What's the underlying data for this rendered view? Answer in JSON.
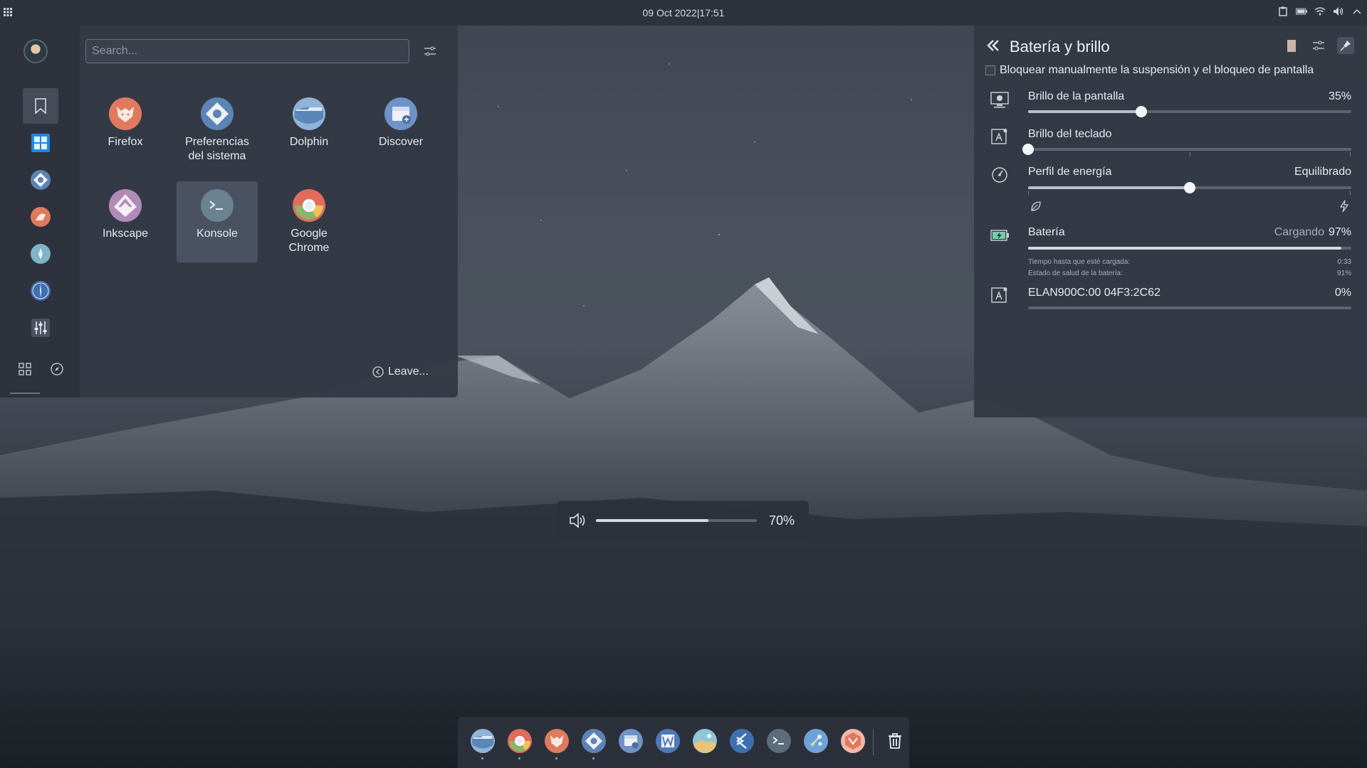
{
  "topbar": {
    "datetime": "09 Oct 2022|17:51",
    "tray_icons": [
      "clipboard-icon",
      "battery-icon",
      "wifi-icon",
      "volume-icon",
      "chevron-up-icon"
    ]
  },
  "menu": {
    "search_placeholder": "Search...",
    "apps": [
      {
        "label": "Firefox",
        "icon": "firefox-icon"
      },
      {
        "label": "Preferencias del sistema",
        "icon": "system-settings-icon"
      },
      {
        "label": "Dolphin",
        "icon": "folder-icon"
      },
      {
        "label": "Discover",
        "icon": "store-icon"
      },
      {
        "label": "Inkscape",
        "icon": "inkscape-icon"
      },
      {
        "label": "Konsole",
        "icon": "terminal-icon"
      },
      {
        "label": "Google Chrome",
        "icon": "chrome-icon"
      }
    ],
    "leave_label": "Leave...",
    "sidebar_icons": [
      "bookmark-icon",
      "apps-grid-icon",
      "system-settings-icon",
      "paint-icon",
      "clock-icon",
      "compass-icon",
      "mixer-icon"
    ]
  },
  "battery_panel": {
    "title": "Batería y brillo",
    "inhibit_label": "Bloquear manualmente la suspensión y el bloqueo de pantalla",
    "screen_brightness": {
      "label": "Brillo de la pantalla",
      "value": "35%",
      "level": 0.35
    },
    "keyboard_brightness": {
      "label": "Brillo del teclado",
      "level": 0.0
    },
    "power_profile": {
      "label": "Perfil de energía",
      "value": "Equilibrado",
      "level": 0.5
    },
    "battery": {
      "label": "Batería",
      "status": "Cargando",
      "value": "97%",
      "level": 0.97,
      "time_label": "Tiempo hasta que esté cargada:",
      "time_value": "0:33",
      "health_label": "Estado de salud de la batería:",
      "health_value": "91%"
    },
    "device": {
      "label": "ELAN900C:00 04F3:2C62",
      "value": "0%",
      "level": 0.0
    }
  },
  "osd": {
    "value": "70%",
    "level": 0.7
  },
  "dock": {
    "items": [
      "folder-icon",
      "chrome-icon",
      "firefox-icon",
      "system-settings-icon",
      "store-icon",
      "writer-icon",
      "image-viewer-icon",
      "vscode-icon",
      "terminal-icon",
      "kdeconnect-icon",
      "software-icon"
    ],
    "trash": "trash-icon"
  }
}
